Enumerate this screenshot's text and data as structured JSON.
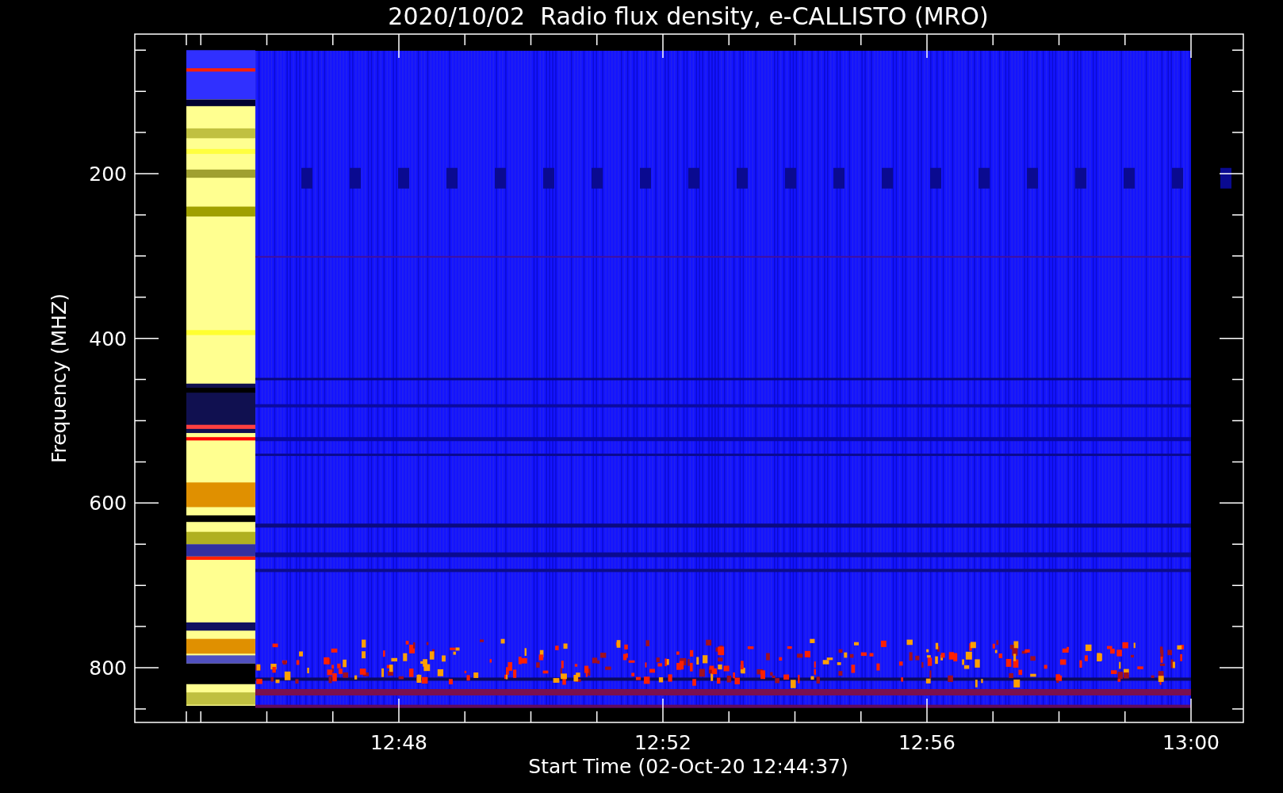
{
  "title": "2020/10/02  Radio flux density, e-CALLISTO (MRO)",
  "y_axis": {
    "label": "Frequency (MHZ)",
    "ticks": [
      "200",
      "400",
      "600",
      "800"
    ]
  },
  "x_axis": {
    "label": "Start Time (02-Oct-20 12:44:37)",
    "ticks": [
      "12:48",
      "12:52",
      "12:56",
      "13:00"
    ]
  }
}
